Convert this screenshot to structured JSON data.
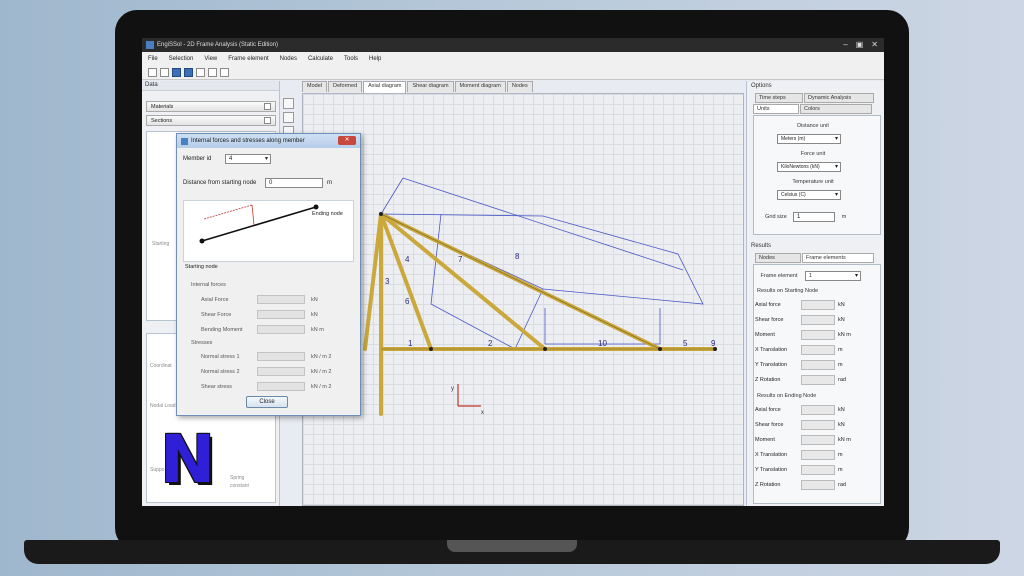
{
  "window": {
    "title": "EngiSSol - 2D Frame Analysis (Static Edition)"
  },
  "menu": [
    "File",
    "Selection",
    "View",
    "Frame element",
    "Nodes",
    "Calculate",
    "Tools",
    "Help"
  ],
  "left_panel": {
    "header": "Data",
    "items": [
      "Materials",
      "Sections"
    ],
    "faint_labels": [
      "Starting",
      "Coordinat",
      "Nodal Load",
      "Suppo",
      "Spring",
      "constant"
    ]
  },
  "tabs": [
    "Model",
    "Deformed",
    "Axial diagram",
    "Shear diagram",
    "Moment diagram",
    "Nodes"
  ],
  "active_tab": "Axial diagram",
  "diagram": {
    "member_labels": [
      "1",
      "2",
      "3",
      "4",
      "5",
      "6",
      "7",
      "8",
      "9",
      "10"
    ],
    "axis_x": "x",
    "axis_y": "y"
  },
  "options": {
    "header": "Options",
    "tabs_row1": [
      "Time steps",
      "Dynamic Analysis"
    ],
    "tabs_row2": [
      "Units",
      "Colors"
    ],
    "distance_unit_label": "Distance unit",
    "distance_unit": "Meters (m)",
    "force_unit_label": "Force unit",
    "force_unit": "KiloNewtons (kN)",
    "temperature_unit_label": "Temperature unit",
    "temperature_unit": "Celsius (C)",
    "grid_size_label": "Grid size",
    "grid_size": "1",
    "grid_size_unit": "m"
  },
  "results": {
    "header": "Results",
    "tabs": [
      "Nodes",
      "Frame elements"
    ],
    "frame_element_label": "Frame element",
    "frame_element": "1",
    "starting_title": "Results on Starting Node",
    "starting_rows": [
      {
        "label": "Axial force",
        "unit": "kN"
      },
      {
        "label": "Shear force",
        "unit": "kN"
      },
      {
        "label": "Moment",
        "unit": "kN m"
      },
      {
        "label": "X Translation",
        "unit": "m"
      },
      {
        "label": "Y Translation",
        "unit": "m"
      },
      {
        "label": "Z Rotation",
        "unit": "rad"
      }
    ],
    "ending_title": "Results on Ending Node",
    "ending_rows": [
      {
        "label": "Axial force",
        "unit": "kN"
      },
      {
        "label": "Shear force",
        "unit": "kN"
      },
      {
        "label": "Moment",
        "unit": "kN m"
      },
      {
        "label": "X Translation",
        "unit": "m"
      },
      {
        "label": "Y Translation",
        "unit": "m"
      },
      {
        "label": "Z Rotation",
        "unit": "rad"
      }
    ]
  },
  "dialog": {
    "title": "Internal forces and stresses along member",
    "close": "✕",
    "member_label": "Member id",
    "member_value": "4",
    "distance_label": "Distance from starting node",
    "distance_value": "0",
    "distance_unit": "m",
    "ending_node": "Ending node",
    "starting_node": "Starting node",
    "internal_forces_title": "Internal forces",
    "forces": [
      {
        "label": "Axial Force",
        "unit": "kN"
      },
      {
        "label": "Shear Force",
        "unit": "kN"
      },
      {
        "label": "Bending Moment",
        "unit": "kN m"
      }
    ],
    "stresses_title": "Stresses",
    "stresses": [
      {
        "label": "Normal stress 1",
        "unit": "kN / m 2"
      },
      {
        "label": "Normal stress 2",
        "unit": "kN / m 2"
      },
      {
        "label": "Shear stress",
        "unit": "kN / m 2"
      }
    ],
    "close_button": "Close"
  },
  "logo": {
    "letter": "N",
    "color": "#2f1fd6"
  }
}
